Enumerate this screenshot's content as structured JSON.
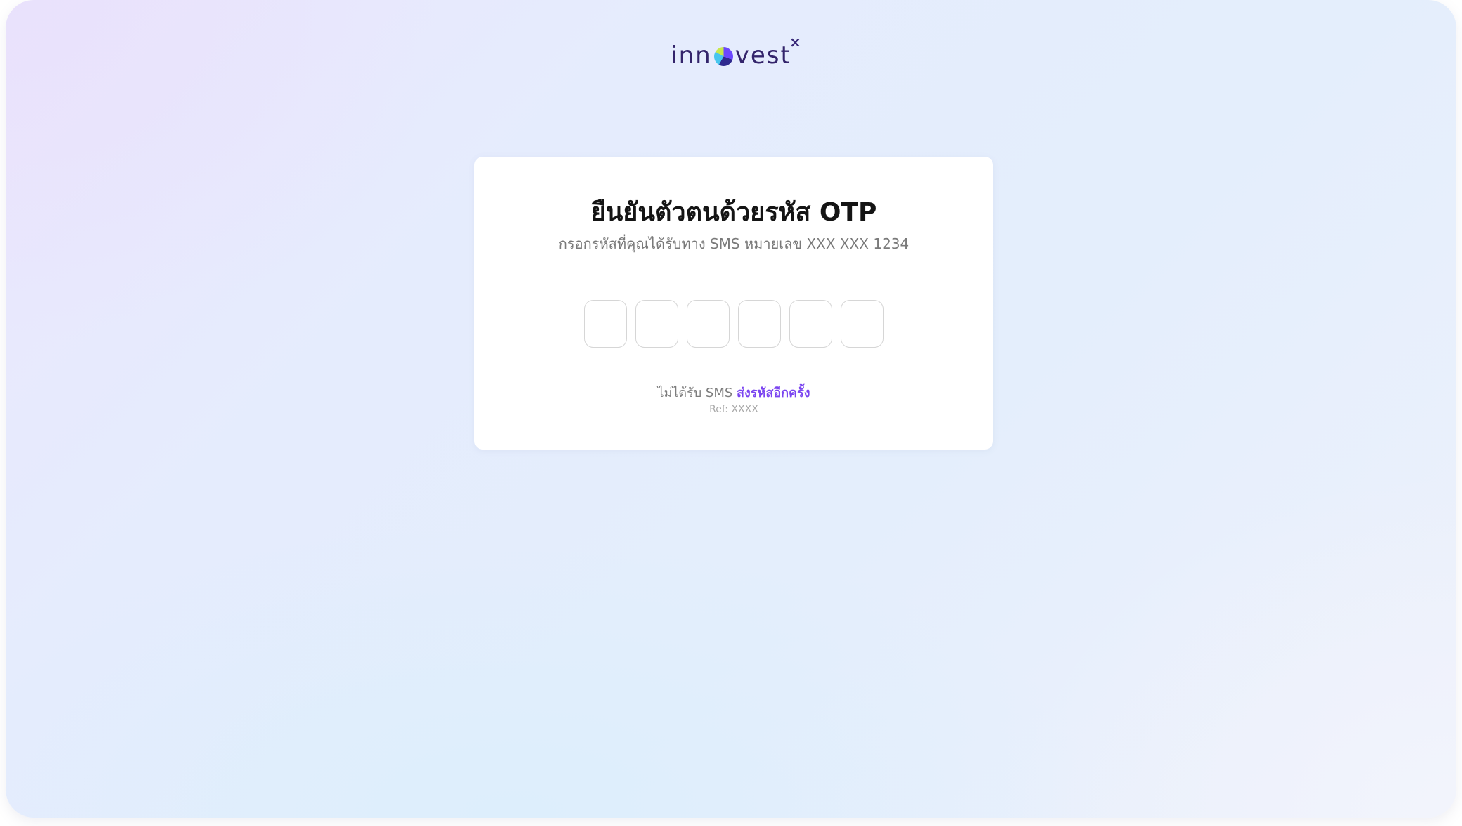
{
  "brand": {
    "name_part1": "inn",
    "name_part2": "vest",
    "superscript": "×",
    "dot_icon": "innovest-logo-dot"
  },
  "card": {
    "title": "ยืนยันตัวตนด้วยรหัส OTP",
    "subtitle": "กรอกรหัสที่คุณได้รับทาง SMS หมายเลข XXX XXX 1234",
    "otp": {
      "length": 6,
      "values": [
        "",
        "",
        "",
        "",
        "",
        ""
      ]
    },
    "resend_prompt": "ไม่ได้รับ SMS",
    "resend_link": "ส่งรหัสอีกครั้ง",
    "ref": "Ref: XXXX"
  },
  "colors": {
    "accent": "#7b45f0",
    "logo_text": "#33246b",
    "title": "#141414",
    "muted": "#7a7a7a"
  }
}
